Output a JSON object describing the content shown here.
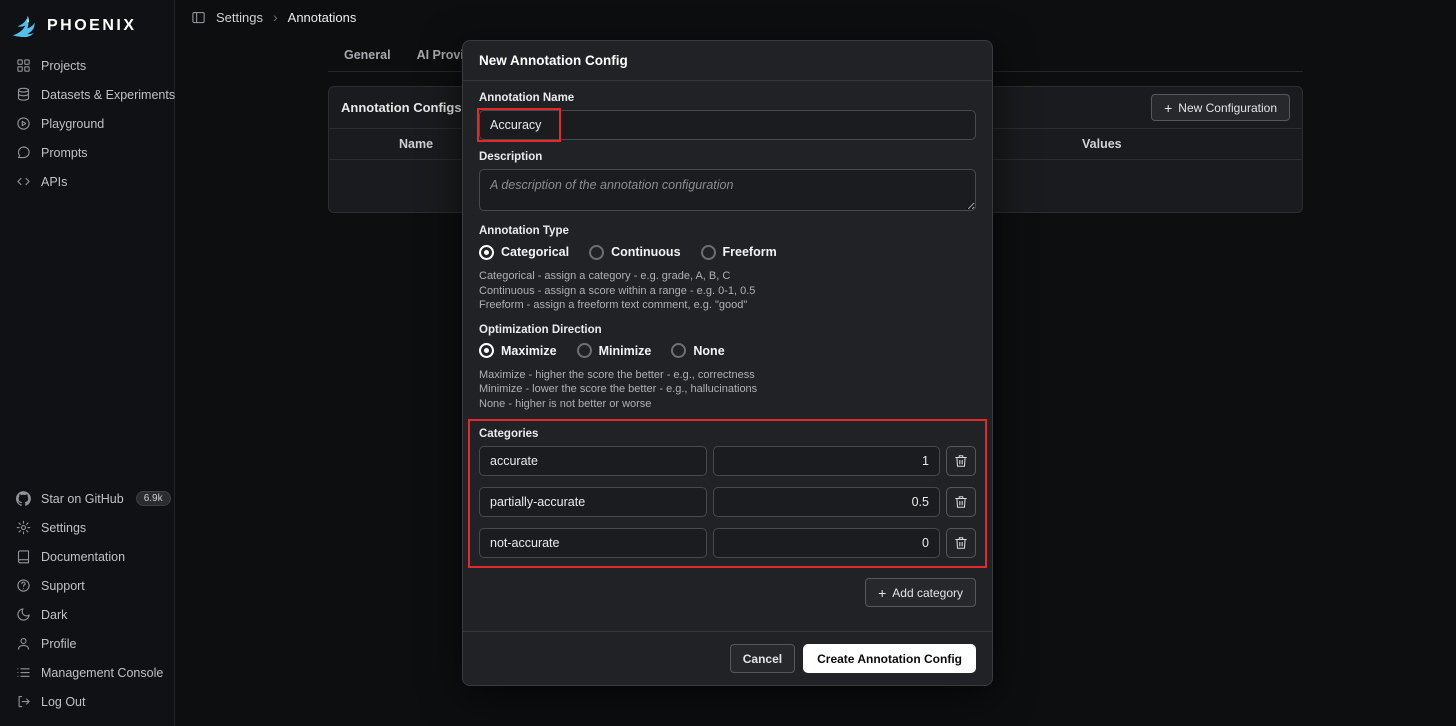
{
  "colors": {
    "accent": "#54bfec",
    "highlight": "#e02b2b"
  },
  "sidebar": {
    "logo_text": "PHOENIX",
    "nav": [
      {
        "label": "Projects",
        "icon": "grid-icon"
      },
      {
        "label": "Datasets & Experiments",
        "icon": "database-icon"
      },
      {
        "label": "Playground",
        "icon": "play-icon"
      },
      {
        "label": "Prompts",
        "icon": "chat-icon"
      },
      {
        "label": "APIs",
        "icon": "code-icon"
      }
    ],
    "bottom": [
      {
        "label": "Star on GitHub",
        "icon": "github-icon",
        "badge": "6.9k"
      },
      {
        "label": "Settings",
        "icon": "gear-icon"
      },
      {
        "label": "Documentation",
        "icon": "book-icon"
      },
      {
        "label": "Support",
        "icon": "help-icon"
      },
      {
        "label": "Dark",
        "icon": "moon-icon"
      },
      {
        "label": "Profile",
        "icon": "person-icon"
      },
      {
        "label": "Management Console",
        "icon": "console-icon"
      },
      {
        "label": "Log Out",
        "icon": "logout-icon"
      }
    ]
  },
  "breadcrumb": {
    "items": [
      "Settings",
      "Annotations"
    ],
    "separator": "›"
  },
  "tabs": [
    {
      "label": "General"
    },
    {
      "label": "AI Providers"
    }
  ],
  "table": {
    "title": "Annotation Configs",
    "new_button": "New Configuration",
    "columns": {
      "name": "Name",
      "values": "Values"
    }
  },
  "modal": {
    "title": "New Annotation Config",
    "annotation_name": {
      "label": "Annotation Name",
      "value": "Accuracy"
    },
    "description": {
      "label": "Description",
      "placeholder": "A description of the annotation configuration"
    },
    "annotation_type": {
      "label": "Annotation Type",
      "options": [
        {
          "label": "Categorical",
          "selected": true
        },
        {
          "label": "Continuous",
          "selected": false
        },
        {
          "label": "Freeform",
          "selected": false
        }
      ],
      "help": [
        "Categorical - assign a category - e.g. grade, A, B, C",
        "Continuous - assign a score within a range - e.g. 0-1, 0.5",
        "Freeform - assign a freeform text comment, e.g. \"good\""
      ]
    },
    "optimization_direction": {
      "label": "Optimization Direction",
      "options": [
        {
          "label": "Maximize",
          "selected": true
        },
        {
          "label": "Minimize",
          "selected": false
        },
        {
          "label": "None",
          "selected": false
        }
      ],
      "help": [
        "Maximize - higher the score the better - e.g., correctness",
        "Minimize - lower the score the better - e.g., hallucinations",
        "None - higher is not better or worse"
      ]
    },
    "categories": {
      "label": "Categories",
      "rows": [
        {
          "name": "accurate",
          "value": "1"
        },
        {
          "name": "partially-accurate",
          "value": "0.5"
        },
        {
          "name": "not-accurate",
          "value": "0"
        }
      ],
      "add_button": "Add category"
    },
    "cancel_button": "Cancel",
    "create_button": "Create Annotation Config"
  }
}
